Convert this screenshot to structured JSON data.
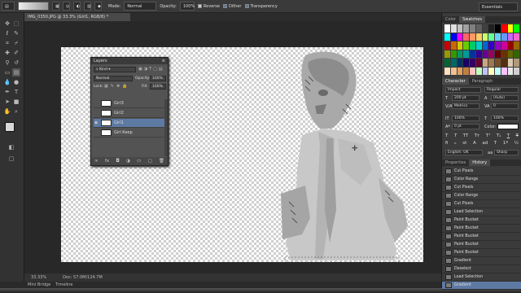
{
  "options_bar": {
    "mode_label": "Mode:",
    "mode_value": "Normal",
    "opacity_label": "Opacity:",
    "opacity_value": "100%",
    "reverse_label": "Reverse",
    "dither_label": "Dither",
    "transparency_label": "Transparency",
    "workspace": "Essentials"
  },
  "document": {
    "tab_title": "IMG_0350.JPG @ 33.3% (Girl1, RGB/8) *",
    "zoom": "33.33%",
    "doc_size": "Doc: 57.0M/124.7M"
  },
  "bottom_tabs": [
    "Mini Bridge",
    "Timeline"
  ],
  "layers_panel": {
    "title": "Layers",
    "kind_label": "Kind",
    "blend_mode": "Normal",
    "opacity_label": "Opacity:",
    "opacity_value": "100%",
    "lock_label": "Lock:",
    "fill_label": "Fill:",
    "fill_value": "100%",
    "layers": [
      {
        "name": "Girl3",
        "selected": false,
        "visible": false
      },
      {
        "name": "Girl2",
        "selected": false,
        "visible": false
      },
      {
        "name": "Girl1",
        "selected": true,
        "visible": true
      },
      {
        "name": "Girl Keep",
        "selected": false,
        "visible": false
      }
    ],
    "footer_icons": [
      "link-icon",
      "fx-icon",
      "mask-icon",
      "adjustment-icon",
      "folder-icon",
      "new-layer-icon",
      "trash-icon"
    ]
  },
  "swatches_panel": {
    "tabs": [
      "Color",
      "Swatches"
    ],
    "active_tab": "Swatches",
    "colors": [
      "#ffffff",
      "#e0e0e0",
      "#c0c0c0",
      "#a0a0a0",
      "#808080",
      "#606060",
      "#404040",
      "#202020",
      "#000000",
      "#ff0000",
      "#ffff00",
      "#00ff00",
      "#00ffff",
      "#0000ff",
      "#ff00ff",
      "#ff6666",
      "#ff9966",
      "#ffcc66",
      "#ccff66",
      "#66ff99",
      "#66ccff",
      "#6699ff",
      "#cc66ff",
      "#ff66cc",
      "#cc0000",
      "#cc6600",
      "#cccc00",
      "#66cc00",
      "#00cc66",
      "#00cccc",
      "#0066cc",
      "#3300cc",
      "#9900cc",
      "#cc0099",
      "#990000",
      "#996600",
      "#999900",
      "#339900",
      "#009966",
      "#009999",
      "#003399",
      "#330099",
      "#660099",
      "#990066",
      "#660000",
      "#663300",
      "#666600",
      "#336600",
      "#006633",
      "#006666",
      "#003366",
      "#1a0066",
      "#330066",
      "#660033",
      "#c8a882",
      "#a07850",
      "#785028",
      "#503010",
      "#d8c8b0",
      "#b09878",
      "#ffe0c0",
      "#f0c090",
      "#e0a060",
      "#c08040",
      "#ffc0c0",
      "#c0ffc0",
      "#c0c0ff",
      "#ffffc0",
      "#c0ffff",
      "#ffc0ff",
      "#e8e8e8",
      "#d0d0d0"
    ]
  },
  "character_panel": {
    "tabs": [
      "Character",
      "Paragraph"
    ],
    "active_tab": "Character",
    "font_family": "Impact",
    "font_style": "Regular",
    "font_size": "200 pt",
    "leading": "(Auto)",
    "kerning": "Metrics",
    "tracking": "0",
    "vscale": "100%",
    "hscale": "100%",
    "baseline": "0 pt",
    "color_label": "Color:",
    "language": "English: UK",
    "antialias": "Sharp"
  },
  "history_panel": {
    "tabs": [
      "Properties",
      "History"
    ],
    "active_tab": "History",
    "items": [
      {
        "label": "Cut Pixels",
        "icon": "doc-icon",
        "selected": false
      },
      {
        "label": "Color Range",
        "icon": "doc-icon",
        "selected": false
      },
      {
        "label": "Cut Pixels",
        "icon": "doc-icon",
        "selected": false
      },
      {
        "label": "Color Range",
        "icon": "doc-icon",
        "selected": false
      },
      {
        "label": "Cut Pixels",
        "icon": "doc-icon",
        "selected": false
      },
      {
        "label": "Load Selection",
        "icon": "doc-icon",
        "selected": false
      },
      {
        "label": "Paint Bucket",
        "icon": "bucket-icon",
        "selected": false
      },
      {
        "label": "Paint Bucket",
        "icon": "bucket-icon",
        "selected": false
      },
      {
        "label": "Paint Bucket",
        "icon": "bucket-icon",
        "selected": false
      },
      {
        "label": "Paint Bucket",
        "icon": "bucket-icon",
        "selected": false
      },
      {
        "label": "Paint Bucket",
        "icon": "bucket-icon",
        "selected": false
      },
      {
        "label": "Gradient",
        "icon": "doc-icon",
        "selected": false
      },
      {
        "label": "Deselect",
        "icon": "doc-icon",
        "selected": false
      },
      {
        "label": "Load Selection",
        "icon": "doc-icon",
        "selected": false
      },
      {
        "label": "Gradient",
        "icon": "doc-icon",
        "selected": true
      }
    ]
  },
  "tools": [
    "move-tool-icon",
    "marquee-tool-icon",
    "lasso-tool-icon",
    "quick-select-tool-icon",
    "crop-tool-icon",
    "eyedropper-tool-icon",
    "healing-brush-icon",
    "brush-tool-icon",
    "clone-stamp-icon",
    "history-brush-icon",
    "eraser-tool-icon",
    "gradient-tool-icon",
    "blur-tool-icon",
    "dodge-tool-icon",
    "pen-tool-icon",
    "type-tool-icon",
    "path-select-icon",
    "shape-tool-icon",
    "hand-tool-icon",
    "zoom-tool-icon"
  ]
}
